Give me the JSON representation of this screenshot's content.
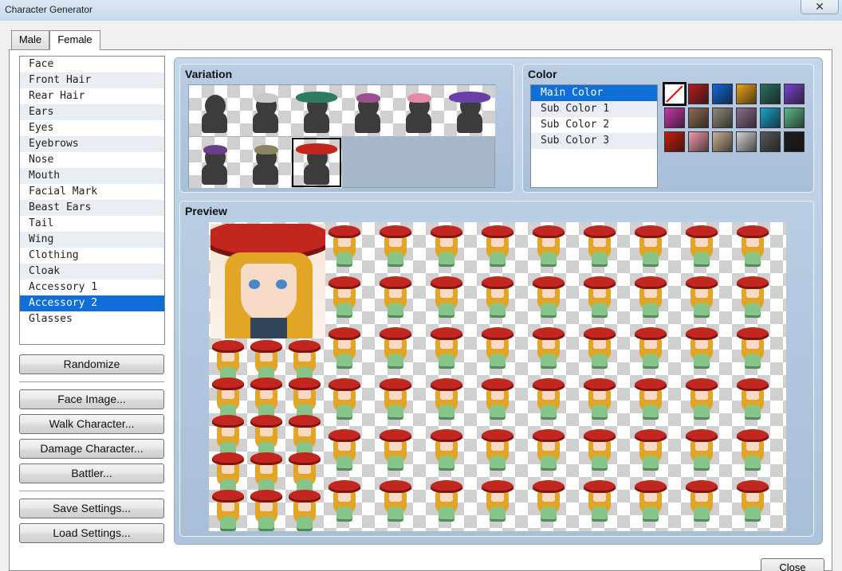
{
  "window": {
    "title": "Character Generator",
    "close_glyph": "✕"
  },
  "tabs": [
    {
      "label": "Male"
    },
    {
      "label": "Female"
    }
  ],
  "parts": {
    "items": [
      "Face",
      "Front Hair",
      "Rear Hair",
      "Ears",
      "Eyes",
      "Eyebrows",
      "Nose",
      "Mouth",
      "Facial Mark",
      "Beast Ears",
      "Tail",
      "Wing",
      "Clothing",
      "Cloak",
      "Accessory 1",
      "Accessory 2",
      "Glasses"
    ],
    "selected": "Accessory 2"
  },
  "buttons": {
    "randomize": "Randomize",
    "face_image": "Face Image...",
    "walk_character": "Walk Character...",
    "damage_character": "Damage Character...",
    "battler": "Battler...",
    "save_settings": "Save Settings...",
    "load_settings": "Load Settings...",
    "close": "Close"
  },
  "variation": {
    "title": "Variation",
    "options": [
      {
        "name": "none",
        "hat_color": ""
      },
      {
        "name": "headband",
        "hat_color": "#c9c9c9"
      },
      {
        "name": "green witch hat",
        "hat_color": "#2f7a63"
      },
      {
        "name": "purple cap",
        "hat_color": "#9b4f8e"
      },
      {
        "name": "pink bonnet",
        "hat_color": "#e38aa6"
      },
      {
        "name": "purple witch hat",
        "hat_color": "#6a3fa8"
      },
      {
        "name": "ribbon",
        "hat_color": "#6b3e8c"
      },
      {
        "name": "headphones",
        "hat_color": "#8c8460"
      },
      {
        "name": "red wide hat",
        "hat_color": "#c3261f"
      }
    ],
    "selected_index": 8
  },
  "color": {
    "title": "Color",
    "items": [
      "Main Color",
      "Sub Color 1",
      "Sub Color 2",
      "Sub Color 3"
    ],
    "selected": "Main Color",
    "swatches": [
      "none",
      "#b32020",
      "#1466d8",
      "#e8a21a",
      "#2e6e62",
      "#7a44c8",
      "#c83aa8",
      "#8c6b54",
      "#8f8a78",
      "#8c6c88",
      "#1ea0c8",
      "#5cb88a",
      "#c81e0e",
      "#f09aaa",
      "#c8b090",
      "#d2d2d2",
      "#585858",
      "#1e1e1e"
    ]
  },
  "preview": {
    "title": "Preview"
  },
  "colors": {
    "accent": "#0f6fd6",
    "hat": "#c3261f",
    "hair": "#e3a526",
    "clothing": "#86c489"
  }
}
